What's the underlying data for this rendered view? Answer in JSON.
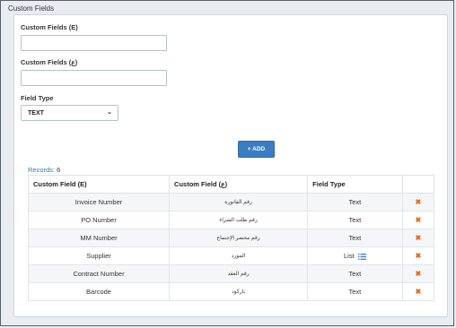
{
  "section_title": "Custom Fields",
  "form": {
    "field_e_label": "Custom Fields (E)",
    "field_e_value": "",
    "field_a_label": "Custom Fields (ع)",
    "field_a_value": "",
    "field_type_label": "Field Type",
    "field_type_value": "TEXT",
    "add_label": "+ ADD"
  },
  "records": {
    "label": "Records:",
    "count": "6"
  },
  "table": {
    "headers": [
      "Custom Field (E)",
      "Custom Field (ع)",
      "Field Type",
      ""
    ],
    "rows": [
      {
        "e": "Invoice Number",
        "a": "رقم الفاتورة",
        "type": "Text"
      },
      {
        "e": "PO Number",
        "a": "رقم طلب الشراء",
        "type": "Text"
      },
      {
        "e": "MM Number",
        "a": "رقم محضر الإجتماع",
        "type": "Text"
      },
      {
        "e": "Supplier",
        "a": "المورد",
        "type": "List"
      },
      {
        "e": "Contract Number",
        "a": "رقم العقد",
        "type": "Text"
      },
      {
        "e": "Barcode",
        "a": "باركود",
        "type": "Text"
      }
    ]
  },
  "icons": {
    "delete": "close-icon",
    "list": "list-icon",
    "chevron": "chevron-down-icon"
  },
  "colors": {
    "accent": "#3b7dc3",
    "delete": "#e06d1f",
    "records_label": "#2d7fa8"
  }
}
